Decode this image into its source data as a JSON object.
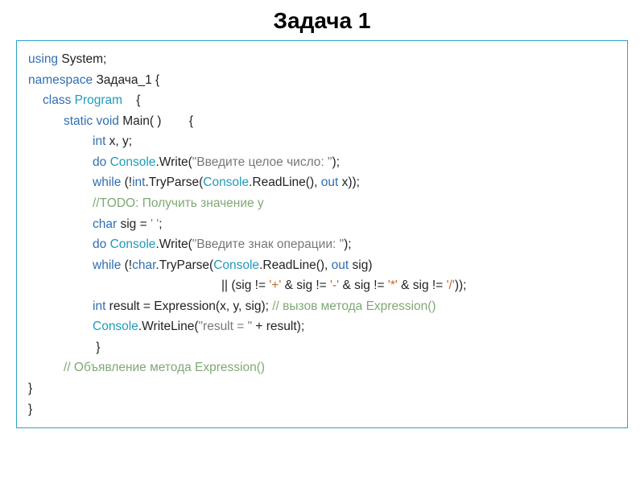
{
  "title": "Задача 1",
  "code": {
    "l1a": "using",
    "l1b": " System;",
    "l2a": "namespace",
    "l2b": " Задача_1 {",
    "l3a": "class ",
    "l3b": "Program",
    "l3c": "    {",
    "l4a": "static void ",
    "l4b": "Main( )        {",
    "l5a": "int",
    "l5b": " x, y;",
    "l6a": "do ",
    "l6b": "Console",
    "l6c": ".Write(",
    "l6d": "\"Введите целое число: \"",
    "l6e": ");",
    "l7a": "while ",
    "l7b": "(!",
    "l7c": "int",
    "l7d": ".TryParse(",
    "l7e": "Console",
    "l7f": ".ReadLine(), ",
    "l7g": "out",
    "l7h": " x));",
    "l8": "//TODO: Получить значение y",
    "l9a": "char",
    "l9b": " sig = ",
    "l9c": "' '",
    "l9d": ";",
    "l10a": "do ",
    "l10b": "Console",
    "l10c": ".Write(",
    "l10d": "\"Введите знак операции: \"",
    "l10e": ");",
    "l11a": "while ",
    "l11b": "(!",
    "l11c": "char",
    "l11d": ".TryParse(",
    "l11e": "Console",
    "l11f": ".ReadLine(), ",
    "l11g": "out",
    "l11h": " sig)",
    "l12a": "|| (sig != ",
    "l12b": "'+'",
    "l12c": " & sig != ",
    "l12d": "'-'",
    "l12e": " & sig != ",
    "l12f": "'*'",
    "l12g": " & sig != ",
    "l12h": "'/'",
    "l12i": "));",
    "l13a": "int",
    "l13b": " result = Expression(x, y, sig); ",
    "l13c": "// вызов метода Expression()",
    "l14a": "Console",
    "l14b": ".WriteLine(",
    "l14c": "\"result = \"",
    "l14d": " + result);",
    "l15": " }",
    "l16": "// Объявление метода Expression()",
    "l17": "}",
    "l18": "}"
  }
}
